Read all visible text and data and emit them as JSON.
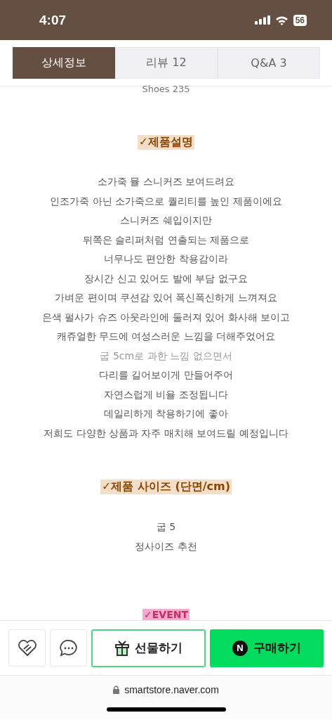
{
  "status_bar": {
    "time": "4:07",
    "battery": "56"
  },
  "tabs": [
    {
      "label": "상세정보",
      "selected": true
    },
    {
      "label": "리뷰  12",
      "selected": false
    },
    {
      "label": "Q&A  3",
      "selected": false
    }
  ],
  "caption": "Shoes 235",
  "sections": [
    {
      "heading": "✓제품설명",
      "lines": [
        {
          "text": "소가죽 뮬 스니커즈 보여드려요",
          "muted": false
        },
        {
          "text": "인조가죽 아닌 소가죽으로 퀄리티를 높인 제품이에요",
          "muted": false
        },
        {
          "text": "스니커즈 쉐입이지만",
          "muted": false
        },
        {
          "text": "뒤쪽은 슬리퍼처럼 연출되는 제품으로",
          "muted": false
        },
        {
          "text": "너무나도 편안한 착용감이라",
          "muted": false
        },
        {
          "text": "장시간 신고 있어도 발에 부담 없구요",
          "muted": false
        },
        {
          "text": "가벼운 편이며 쿠션감 있어 폭신폭신하게 느껴져요",
          "muted": false
        },
        {
          "text": "은색 펄사가 슈즈 아웃라인에 둘러져 있어 화사해 보이고",
          "muted": false
        },
        {
          "text": "캐쥬얼한 무드에 여성스러운 느낌을 더해주었어요",
          "muted": false
        },
        {
          "text": "굽 5cm로 과한 느낌 없으면서",
          "muted": true
        },
        {
          "text": "다리를 길어보이게 만들어주어",
          "muted": false
        },
        {
          "text": "자연스럽게 비율 조정됩니다",
          "muted": false
        },
        {
          "text": "데일리하게 착용하기에 좋아",
          "muted": false
        },
        {
          "text": "저희도 다양한 상품과 자주 매치해 보여드릴 예정입니다",
          "muted": false
        }
      ]
    },
    {
      "heading": "✓제품 사이즈 (단면/cm)",
      "lines": [
        {
          "text": "굽 5",
          "muted": false
        },
        {
          "text": "정사이즈 추천",
          "muted": false
        }
      ]
    }
  ],
  "event_label": "✓EVENT",
  "actions": {
    "gift": "선물하기",
    "buy": "구매하기",
    "buy_logo": "N"
  },
  "url": "smartstore.naver.com"
}
